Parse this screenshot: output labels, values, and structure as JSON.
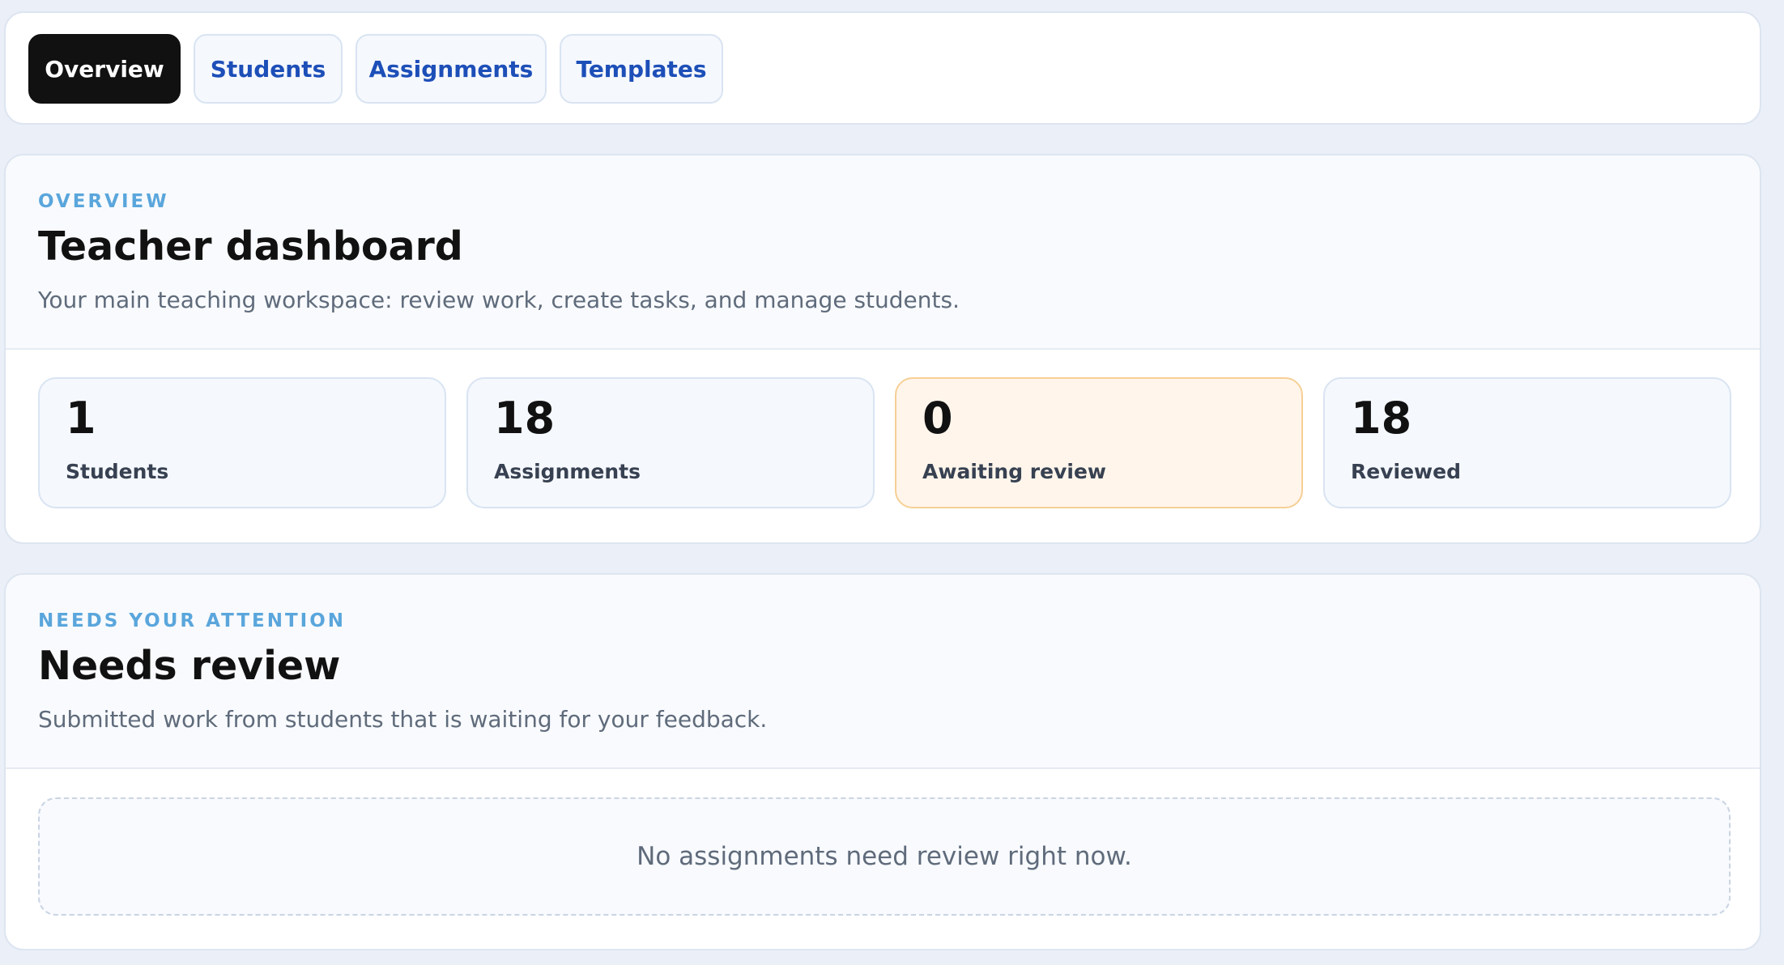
{
  "tabs": [
    {
      "label": "Overview",
      "active": true
    },
    {
      "label": "Students",
      "active": false
    },
    {
      "label": "Assignments",
      "active": false
    },
    {
      "label": "Templates",
      "active": false
    }
  ],
  "overview": {
    "eyebrow": "OVERVIEW",
    "title": "Teacher dashboard",
    "description": "Your main teaching workspace: review work, create tasks, and manage students.",
    "stats": [
      {
        "value": "1",
        "label": "Students"
      },
      {
        "value": "18",
        "label": "Assignments"
      },
      {
        "value": "0",
        "label": "Awaiting review"
      },
      {
        "value": "18",
        "label": "Reviewed"
      }
    ]
  },
  "attention": {
    "eyebrow": "NEEDS YOUR ATTENTION",
    "title": "Needs review",
    "description": "Submitted work from students that is waiting for your feedback.",
    "empty_message": "No assignments need review right now."
  },
  "colors": {
    "background": "#eaeff8",
    "accent_text": "#1d4fb8",
    "eyebrow": "#5aa6dc",
    "active_tab": "#111111",
    "warning_bg": "#fff5eb",
    "warning_border": "#f6cf95"
  }
}
